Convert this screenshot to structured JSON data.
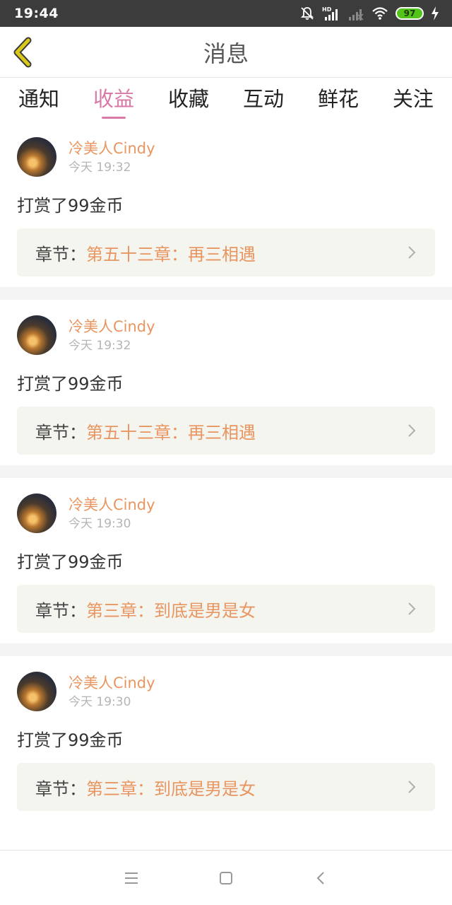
{
  "status_bar": {
    "time": "19:44",
    "hd_label": "HD",
    "battery": "97",
    "icons": [
      "mute-bell-icon",
      "signal-hd-icon",
      "signal-weak-icon",
      "wifi-icon",
      "battery-icon",
      "charging-bolt-icon"
    ]
  },
  "header": {
    "title": "消息",
    "back_icon": "chevron-left-icon"
  },
  "tabs": [
    {
      "label": "通知",
      "active": false
    },
    {
      "label": "收益",
      "active": true
    },
    {
      "label": "收藏",
      "active": false
    },
    {
      "label": "互动",
      "active": false
    },
    {
      "label": "鲜花",
      "active": false
    },
    {
      "label": "关注",
      "active": false
    }
  ],
  "messages": [
    {
      "user": "冷美人Cindy",
      "time": "今天 19:32",
      "text": "打赏了99金币",
      "chapter_prefix": "章节：",
      "chapter": "第五十三章：再三相遇"
    },
    {
      "user": "冷美人Cindy",
      "time": "今天 19:32",
      "text": "打赏了99金币",
      "chapter_prefix": "章节：",
      "chapter": "第五十三章：再三相遇"
    },
    {
      "user": "冷美人Cindy",
      "time": "今天 19:30",
      "text": "打赏了99金币",
      "chapter_prefix": "章节：",
      "chapter": "第三章：到底是男是女"
    },
    {
      "user": "冷美人Cindy",
      "time": "今天 19:30",
      "text": "打赏了99金币",
      "chapter_prefix": "章节：",
      "chapter": "第三章：到底是男是女"
    }
  ],
  "bottom_nav": [
    "menu-icon",
    "home-square-icon",
    "back-triangle-icon"
  ],
  "colors": {
    "accent_tab": "#d97aa6",
    "username": "#e99560",
    "chapter_link": "#e99560",
    "back_chevron": "#c8b400"
  }
}
